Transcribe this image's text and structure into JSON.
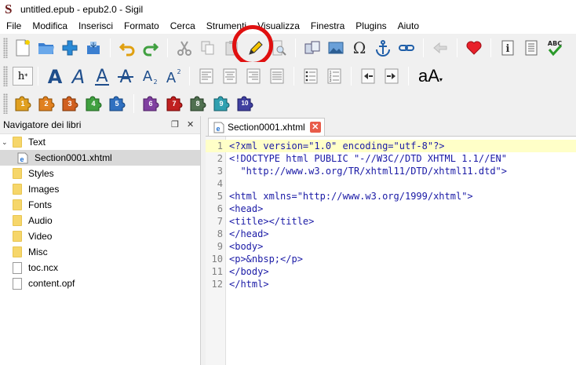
{
  "window": {
    "title": "untitled.epub - epub2.0 - Sigil",
    "app_logo": "S"
  },
  "menu": [
    "File",
    "Modifica",
    "Inserisci",
    "Formato",
    "Cerca",
    "Strumenti",
    "Visualizza",
    "Finestra",
    "Plugins",
    "Aiuto"
  ],
  "toolbar2": {
    "heading_label": "h",
    "heading_sup": "*",
    "case_label": "aA"
  },
  "clip_buttons": [
    "1",
    "2",
    "3",
    "4",
    "5",
    "6",
    "7",
    "8",
    "9",
    "10"
  ],
  "clip_colors": [
    "#e0a020",
    "#e08020",
    "#d06020",
    "#40a040",
    "#3070c0",
    "#8040a0",
    "#c02020",
    "#507050",
    "#30a0b0",
    "#4040a0"
  ],
  "book_browser": {
    "title": "Navigatore dei libri",
    "items": [
      {
        "label": "Text",
        "type": "folder"
      },
      {
        "label": "Section0001.xhtml",
        "type": "xhtml"
      },
      {
        "label": "Styles",
        "type": "folder"
      },
      {
        "label": "Images",
        "type": "folder"
      },
      {
        "label": "Fonts",
        "type": "folder"
      },
      {
        "label": "Audio",
        "type": "folder"
      },
      {
        "label": "Video",
        "type": "folder"
      },
      {
        "label": "Misc",
        "type": "folder"
      },
      {
        "label": "toc.ncx",
        "type": "file"
      },
      {
        "label": "content.opf",
        "type": "file"
      }
    ]
  },
  "tab": {
    "label": "Section0001.xhtml"
  },
  "code": {
    "line_numbers": [
      "1",
      "2",
      "3",
      "4",
      "5",
      "6",
      "7",
      "8",
      "9",
      "10",
      "11",
      "12"
    ],
    "lines": [
      "<?xml version=\"1.0\" encoding=\"utf-8\"?>",
      "<!DOCTYPE html PUBLIC \"-//W3C//DTD XHTML 1.1//EN\"",
      "  \"http://www.w3.org/TR/xhtml11/DTD/xhtml11.dtd\">",
      "",
      "<html xmlns=\"http://www.w3.org/1999/xhtml\">",
      "<head>",
      "<title></title>",
      "</head>",
      "<body>",
      "<p>&nbsp;</p>",
      "</body>",
      "</html>"
    ]
  },
  "colors": {
    "highlight_ring": "#e01010",
    "current_line": "#ffffc8"
  }
}
